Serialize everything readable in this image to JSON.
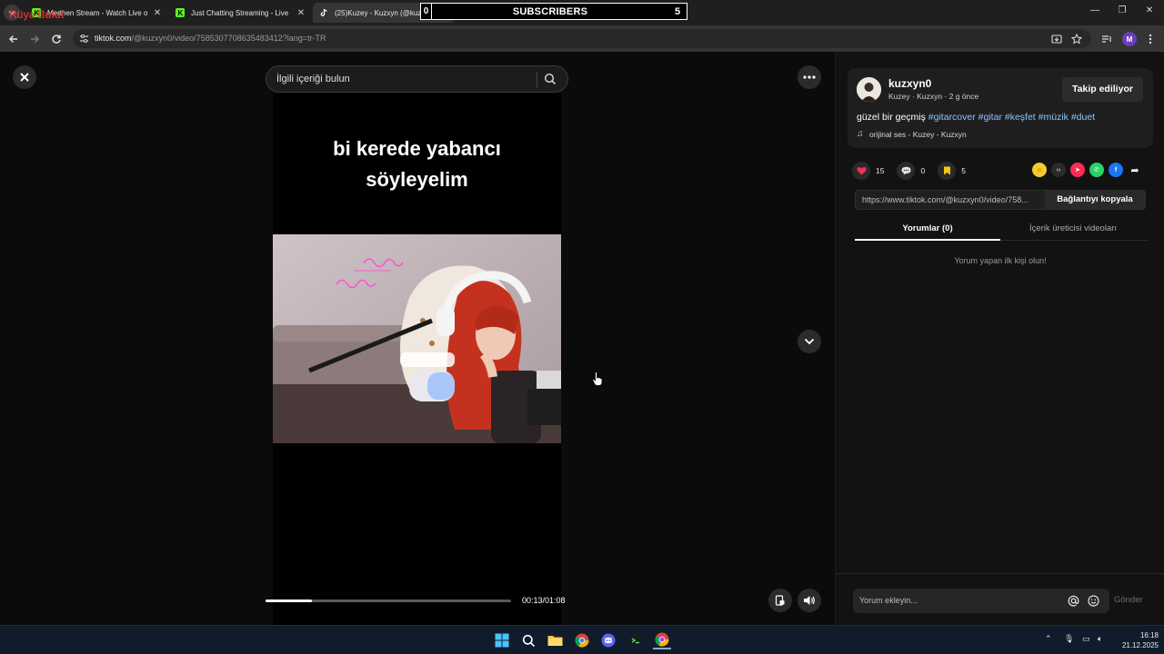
{
  "browser": {
    "overlay_logo": "Rüya Bulut",
    "tabs": [
      {
        "title": "Merthen Stream - Watch Live o",
        "active": false
      },
      {
        "title": "Just Chatting Streaming - Live",
        "active": false
      },
      {
        "title": "(25)Kuzey - Kuzxyn (@kuz",
        "active": true
      }
    ],
    "subscribers_prefix": "0",
    "subscribers_label": "SUBSCRIBERS",
    "subscribers_count": "5",
    "new_tab": "+",
    "url_host": "tiktok.com",
    "url_path": "/@kuzxyn0/video/7585307708635483412?lang=tr-TR",
    "profile_initial": "M"
  },
  "viewer": {
    "search_placeholder": "İlgili içeriği bulun",
    "caption_line1": "bi kerede yabancı",
    "caption_line2": "söyleyelim",
    "progress_fraction": 0.19,
    "time_display": "00:13/01:08",
    "neon_text": "ilkmar"
  },
  "panel": {
    "username": "kuzxyn0",
    "meta": "Kuzey · Kuzxyn · 2 g önce",
    "follow_label": "Takip ediliyor",
    "desc_text": "güzel bir geçmiş",
    "hashtags": [
      "#gitarcover",
      "#gitar",
      "#keşfet",
      "#müzik",
      "#duet"
    ],
    "music": "orijinal ses - Kuzey - Kuzxyn",
    "likes": "15",
    "comments": "0",
    "saves": "5",
    "video_link": "https://www.tiktok.com/@kuzxyn0/video/758...",
    "copy_link_label": "Bağlantıyı kopyala",
    "tab_comments": "Yorumlar (0)",
    "tab_creator_videos": "İçerik üreticisi videoları",
    "empty_comments": "Yorum yapan ilk kişi olun!",
    "comment_placeholder": "Yorum ekleyin...",
    "send_label": "Gönder"
  },
  "taskbar": {
    "time": "16:18",
    "date": "21.12.2025"
  },
  "colors": {
    "accent_like": "#fe2c55",
    "hashtag": "#8cc2ff",
    "save": "#f5c518"
  }
}
